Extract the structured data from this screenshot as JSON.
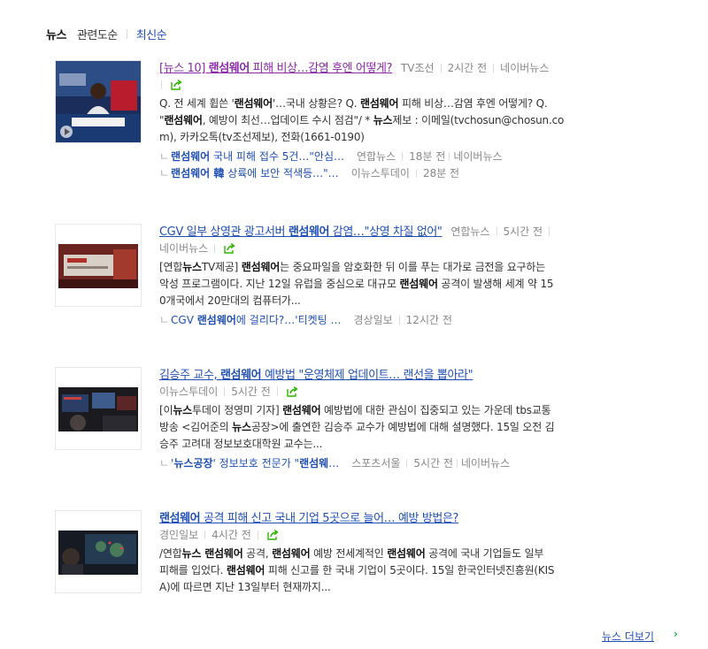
{
  "tabs": [
    {
      "label": "뉴스",
      "active": true
    },
    {
      "label": "관련도순",
      "active": false
    },
    {
      "label": "최신순",
      "active": false
    }
  ],
  "items": [
    {
      "title_pre": "[뉴스 10] ",
      "title_bold": "랜섬웨어",
      "title_post": " 피해 비상…감염 후엔 어떻게?",
      "source": "TV조선",
      "time": "2시간 전",
      "portal": "네이버뉴스",
      "desc1_a": "Q. 전 세계 휩쓴 '",
      "desc1_b": "랜섬웨어",
      "desc1_c": "'…국내 상황은? Q. ",
      "desc1_d": "랜섬웨어",
      "desc1_e": " 피해 비상…감염 후엔 어떻게? Q.",
      "desc2_a": "\"",
      "desc2_b": "랜섬웨어",
      "desc2_c": ", 예방이 최선…업데이트 수시 점검\"/ * ",
      "desc2_d": "뉴스",
      "desc2_e": "제보 : 이메일(tvchosun@chosun.co",
      "desc3": "m), 카카오톡(tv조선제보), 전화(1661-0190)",
      "related": [
        {
          "bold": "랜섬웨어",
          "text": " 국내 피해 접수 5건…\"안심…",
          "source": "연합뉴스",
          "time": "18분 전",
          "portal": "네이버뉴스"
        },
        {
          "bold": "랜섬웨어 韓",
          "text": " 상륙에 보안 적색등…\"…",
          "source": "이뉴스투데이",
          "time": "28분 전",
          "portal": ""
        }
      ]
    },
    {
      "title_pre": "CGV 일부 상영관 광고서버 ",
      "title_bold": "랜섬웨어",
      "title_post": " 감염…\"상영 차질 없어\"",
      "source": "연합뉴스",
      "time": "5시간 전",
      "portal": "네이버뉴스",
      "desc1_a": "[연합",
      "desc1_b": "뉴스",
      "desc1_c": "TV제공] ",
      "desc1_d": "랜섬웨어",
      "desc1_e": "는 중요파일을 암호화한 뒤 이를 푸는 대가로 금전을 요구하는",
      "desc2_a": "악성 프로그램이다. 지난 12일 유럽을 중심으로 대규모 ",
      "desc2_b": "랜섬웨어",
      "desc2_c": " 공격이 발생해 세계 약 15",
      "desc3": "0개국에서 20만대의 컴퓨터가...",
      "related": [
        {
          "pre": "CGV ",
          "bold": "랜섬웨어",
          "text": "에 걸리다?…'티켓팅 …",
          "source": "경상일보",
          "time": "12시간 전",
          "portal": ""
        }
      ]
    },
    {
      "title_pre": "김승주 교수, ",
      "title_bold": "랜섬웨어",
      "title_post": " 예방법 \"운영체제 업데이트… 랜선을 뽑아라\"",
      "source": "이뉴스투데이",
      "time": "5시간 전",
      "desc1_a": "[이",
      "desc1_b": "뉴스",
      "desc1_c": "투데이 정영미 기자] ",
      "desc1_d": "랜섬웨어",
      "desc1_e": " 예방법에 대한 관심이 집중되고 있는 가운데 tbs교통",
      "desc2_a": "방송 <김어준의 ",
      "desc2_b": "뉴스",
      "desc2_c": "공장>에 출연한 김승주 교수가 예방법에 대해 설명했다. 15일 오전 김",
      "desc3": "승주 고려대 정보보호대학원 교수는...",
      "related": [
        {
          "pre": "'",
          "bold": "뉴스공장",
          "text": "' 정보보호 전문가 \"",
          "bold2": "랜섬웨",
          "text2": "…",
          "source": "스포츠서울",
          "time": "5시간 전",
          "portal": "네이버뉴스"
        }
      ]
    },
    {
      "title_pre": "",
      "title_bold": "랜섬웨어",
      "title_post": " 공격 피해 신고 국내 기업 5곳으로 늘어… 예방 방법은?",
      "source": "경인일보",
      "time": "4시간 전",
      "desc1_a": "/연합",
      "desc1_b": "뉴스 랜섬웨어",
      "desc1_c": " 공격, ",
      "desc1_d": "랜섬웨어",
      "desc1_e": " 예방 전세계적인 ",
      "desc1_f": "랜섬웨어",
      "desc1_g": " 공격에 국내 기업들도 일부",
      "desc2_a": "피해를 입었다. ",
      "desc2_b": "랜섬웨어",
      "desc2_c": " 피해 신고를 한 국내 기업이 5곳이다. 15일 한국인터넷진흥원(KIS",
      "desc3": "A)에 따르면 지난 13일부터 현재까지..."
    }
  ],
  "more_label": "뉴스 더보기",
  "more_arrow": "›",
  "related_marker": "ㄴ",
  "colors": {
    "link": "#1f4fb5",
    "visited": "#8b2aa8",
    "share_icon": "#2db400"
  }
}
